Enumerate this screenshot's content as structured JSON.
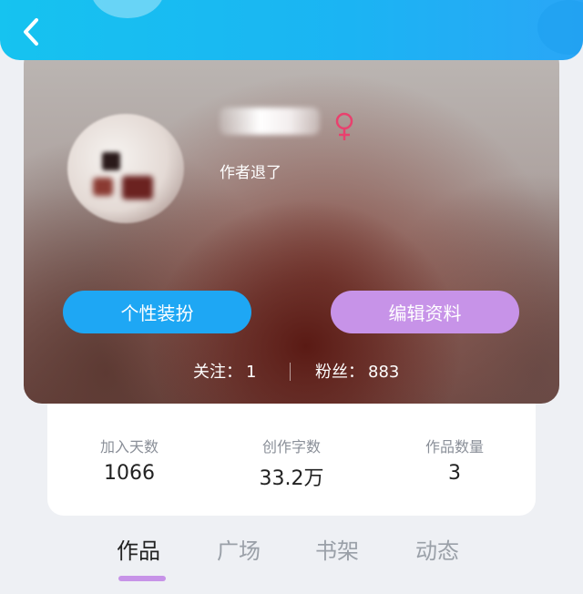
{
  "profile": {
    "signature": "作者退了"
  },
  "buttons": {
    "dress_label": "个性装扮",
    "edit_label": "编辑资料"
  },
  "follow": {
    "following_label": "关注：",
    "following_value": "1",
    "fans_label": "粉丝：",
    "fans_value": "883"
  },
  "stats": [
    {
      "label": "加入天数",
      "value": "1066"
    },
    {
      "label": "创作字数",
      "value": "33.2万"
    },
    {
      "label": "作品数量",
      "value": "3"
    }
  ],
  "tabs": [
    {
      "label": "作品",
      "active": true
    },
    {
      "label": "广场",
      "active": false
    },
    {
      "label": "书架",
      "active": false
    },
    {
      "label": "动态",
      "active": false
    }
  ],
  "colors": {
    "header": "#1bb4f3",
    "primary_button": "#1ea7f4",
    "secondary_button": "#c793e8",
    "gender_female": "#e9416e"
  },
  "icons": {
    "back": "chevron-left-icon",
    "gender": "female-icon"
  }
}
